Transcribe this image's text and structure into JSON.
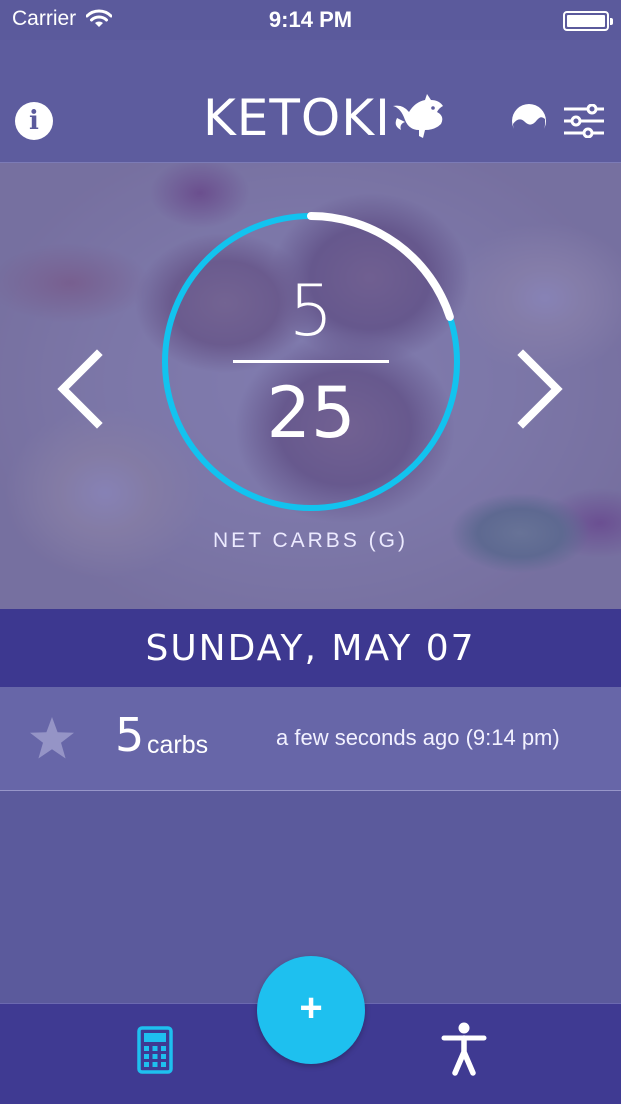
{
  "status": {
    "carrier": "Carrier",
    "time": "9:14 PM"
  },
  "header": {
    "info_label": "i",
    "logo_text": "KETOKI"
  },
  "summary": {
    "net_carbs_value": "5",
    "net_carbs_goal": "25",
    "net_carbs_progress": 0.2,
    "label": "NET CARBS (G)"
  },
  "date": {
    "label": "SUNDAY, MAY 07"
  },
  "entries": [
    {
      "amount": "5",
      "unit": "carbs",
      "time": "a few seconds ago (9:14 pm)"
    }
  ],
  "fab": {
    "label": "+"
  },
  "colors": {
    "primary": "#5b5a9c",
    "date_bar": "#3d3890",
    "accent": "#1ec0ef",
    "ring": "#12c3ef"
  },
  "icons": {
    "info": "info-icon",
    "mode": "moon-wave-icon",
    "settings": "sliders-icon",
    "prev": "chevron-left-icon",
    "next": "chevron-right-icon",
    "favorite": "star-icon",
    "calculator": "calculator-icon",
    "body": "person-icon"
  }
}
